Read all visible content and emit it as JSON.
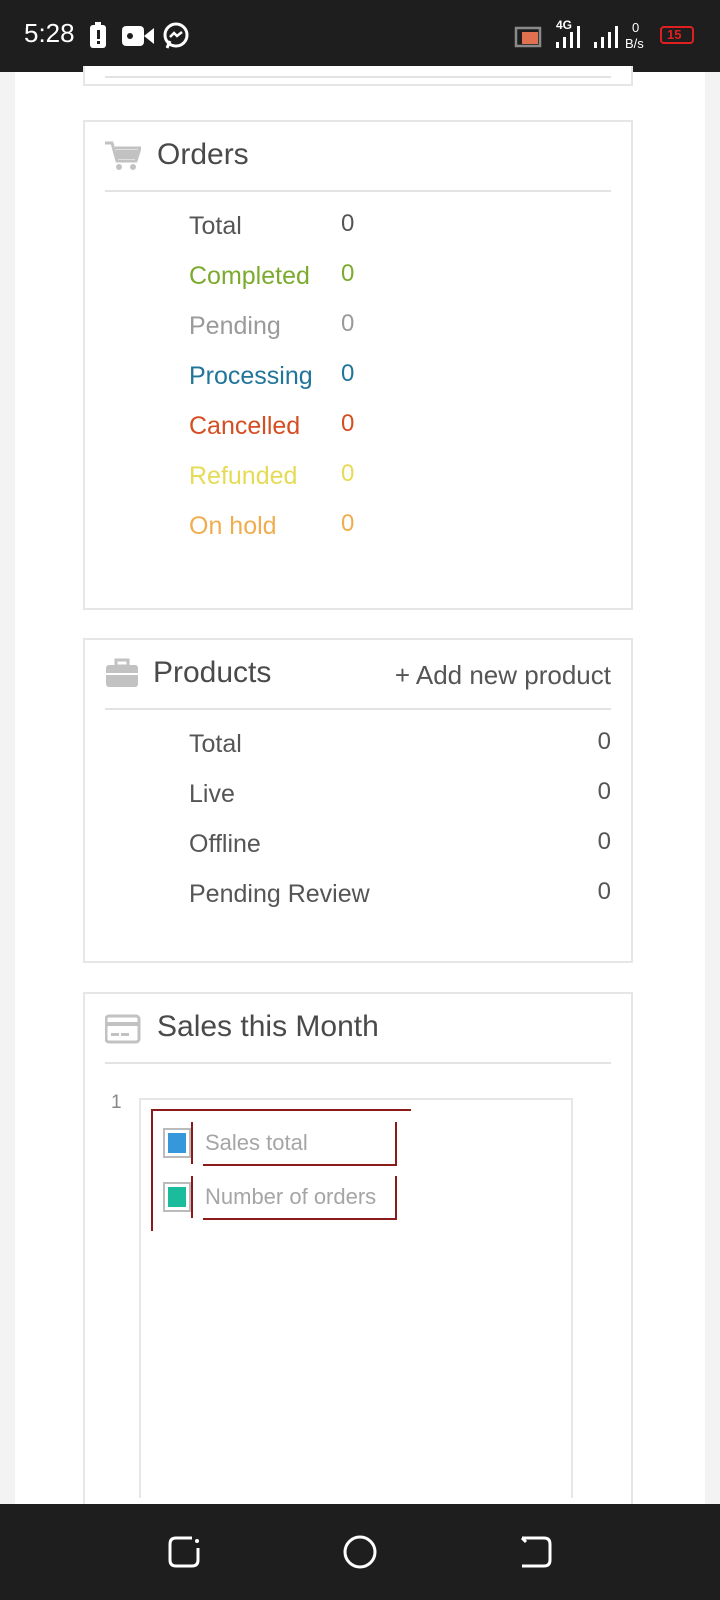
{
  "status_bar": {
    "time": "5:28",
    "network": "4G",
    "speed_value": "0",
    "speed_unit": "B/s",
    "battery": "15"
  },
  "orders": {
    "title": "Orders",
    "icon": "cart-icon",
    "rows": [
      {
        "label": "Total",
        "value": "0",
        "color": "#555555"
      },
      {
        "label": "Completed",
        "value": "0",
        "color": "#7bab2d"
      },
      {
        "label": "Pending",
        "value": "0",
        "color": "#9a9a9a"
      },
      {
        "label": "Processing",
        "value": "0",
        "color": "#21759b"
      },
      {
        "label": "Cancelled",
        "value": "0",
        "color": "#d54e21"
      },
      {
        "label": "Refunded",
        "value": "0",
        "color": "#e6db55"
      },
      {
        "label": "On hold",
        "value": "0",
        "color": "#f0ad4e"
      }
    ]
  },
  "products": {
    "title": "Products",
    "icon": "briefcase-icon",
    "add_link": "+ Add new product",
    "rows": [
      {
        "label": "Total",
        "value": "0"
      },
      {
        "label": "Live",
        "value": "0"
      },
      {
        "label": "Offline",
        "value": "0"
      },
      {
        "label": "Pending Review",
        "value": "0"
      }
    ]
  },
  "sales": {
    "title": "Sales this Month",
    "icon": "credit-card-icon",
    "axis_tick": "1",
    "legend": [
      {
        "label": "Sales total",
        "color": "#3498db"
      },
      {
        "label": "Number of orders",
        "color": "#1abc9c"
      }
    ]
  }
}
